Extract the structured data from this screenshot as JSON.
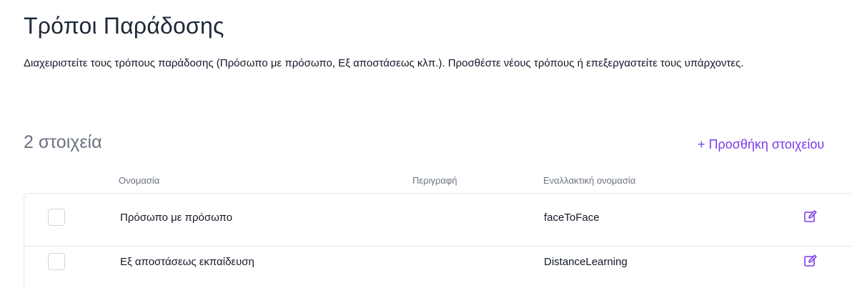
{
  "page": {
    "title": "Τρόποι Παράδοσης",
    "description": "Διαχειριστείτε τους τρόπους παράδοσης (Πρόσωπο με πρόσωπο, Εξ αποστάσεως κλπ.). Προσθέστε νέους τρόπους ή επεξεργαστείτε τους υπάρχοντες."
  },
  "list": {
    "count_label": "2 στοιχεία",
    "add_label": "+ Προσθήκη στοιχείου",
    "columns": {
      "name": "Ονομασία",
      "description": "Περιγραφή",
      "alt_name": "Εναλλακτική ονομασία"
    },
    "rows": [
      {
        "name": "Πρόσωπο με πρόσωπο",
        "description": "",
        "alt_name": "faceToFace"
      },
      {
        "name": "Εξ αποστάσεως εκπαίδευση",
        "description": "",
        "alt_name": "DistanceLearning"
      }
    ]
  },
  "colors": {
    "accent": "#7c3aed",
    "muted_text": "#6b7280",
    "border": "#e5e7eb"
  },
  "icons": {
    "edit": "edit-icon"
  }
}
